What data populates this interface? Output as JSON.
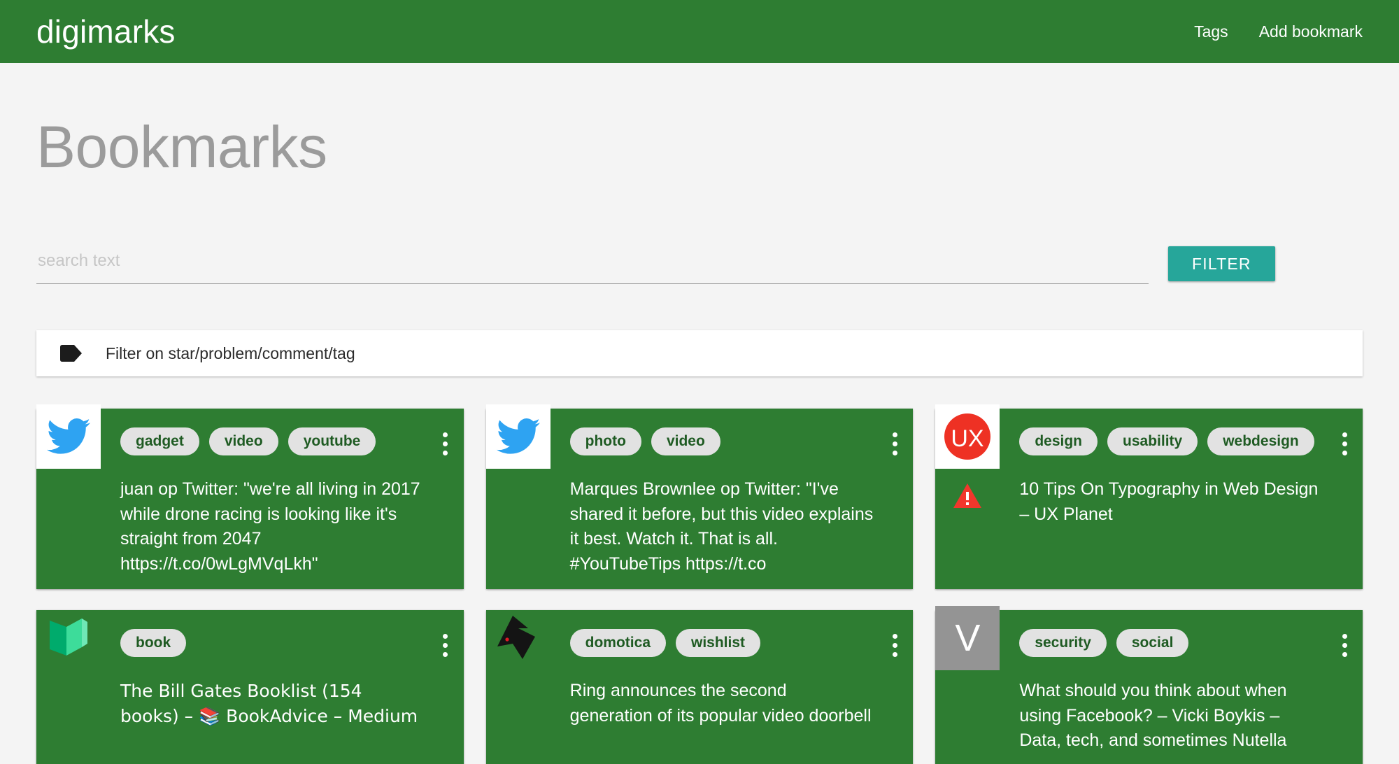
{
  "theme": {
    "brand_green": "#2e7d32",
    "accent_teal": "#26a69a",
    "page_bg": "#f4f4f4",
    "title_gray": "#9b9b9b",
    "pill_bg": "#e2e2e2",
    "pill_text": "#1f5b23",
    "warning_red": "#f1372c"
  },
  "appbar": {
    "brand": "digimarks",
    "links": [
      {
        "label": "Tags",
        "name": "nav-link-tags"
      },
      {
        "label": "Add bookmark",
        "name": "nav-link-add-bookmark"
      }
    ]
  },
  "page": {
    "title": "Bookmarks"
  },
  "search": {
    "value": "",
    "placeholder": "search text",
    "filter_button_label": "FILTER"
  },
  "tag_filter": {
    "icon": "tag-icon",
    "label": "Filter on star/problem/comment/tag"
  },
  "cards": [
    {
      "favicon": {
        "type": "twitter-bird-icon",
        "box": "white",
        "letter": ""
      },
      "tags": [
        "gadget",
        "video",
        "youtube"
      ],
      "warning": false,
      "title": "juan op Twitter: \"we're all living in 2017 while drone racing is looking like it's straight from 2047 https://t.co/0wLgMVqLkh\""
    },
    {
      "favicon": {
        "type": "twitter-bird-icon",
        "box": "white",
        "letter": ""
      },
      "tags": [
        "photo",
        "video"
      ],
      "warning": false,
      "title": "Marques Brownlee op Twitter: \"I've shared it before, but this video explains it best. Watch it. That is all. #YouTubeTips https://t.co"
    },
    {
      "favicon": {
        "type": "ux-planet-icon",
        "box": "white",
        "letter": "UX"
      },
      "tags": [
        "design",
        "usability",
        "webdesign"
      ],
      "warning": true,
      "title": "10 Tips On Typography in Web Design – UX Planet"
    },
    {
      "favicon": {
        "type": "medium-logo-icon",
        "box": "plain",
        "letter": ""
      },
      "tags": [
        "book"
      ],
      "warning": false,
      "title": "The Bill Gates Booklist (154 books) – 📚 BookAdvice – Medium"
    },
    {
      "favicon": {
        "type": "verge-logo-icon",
        "box": "plain",
        "letter": ""
      },
      "tags": [
        "domotica",
        "wishlist"
      ],
      "warning": false,
      "title": "Ring announces the second generation of its popular video doorbell"
    },
    {
      "favicon": {
        "type": "letter-avatar-icon",
        "box": "gray",
        "letter": "V"
      },
      "tags": [
        "security",
        "social"
      ],
      "warning": false,
      "title": "What should you think about when using Facebook? – Vicki Boykis – Data, tech, and sometimes Nutella"
    }
  ]
}
